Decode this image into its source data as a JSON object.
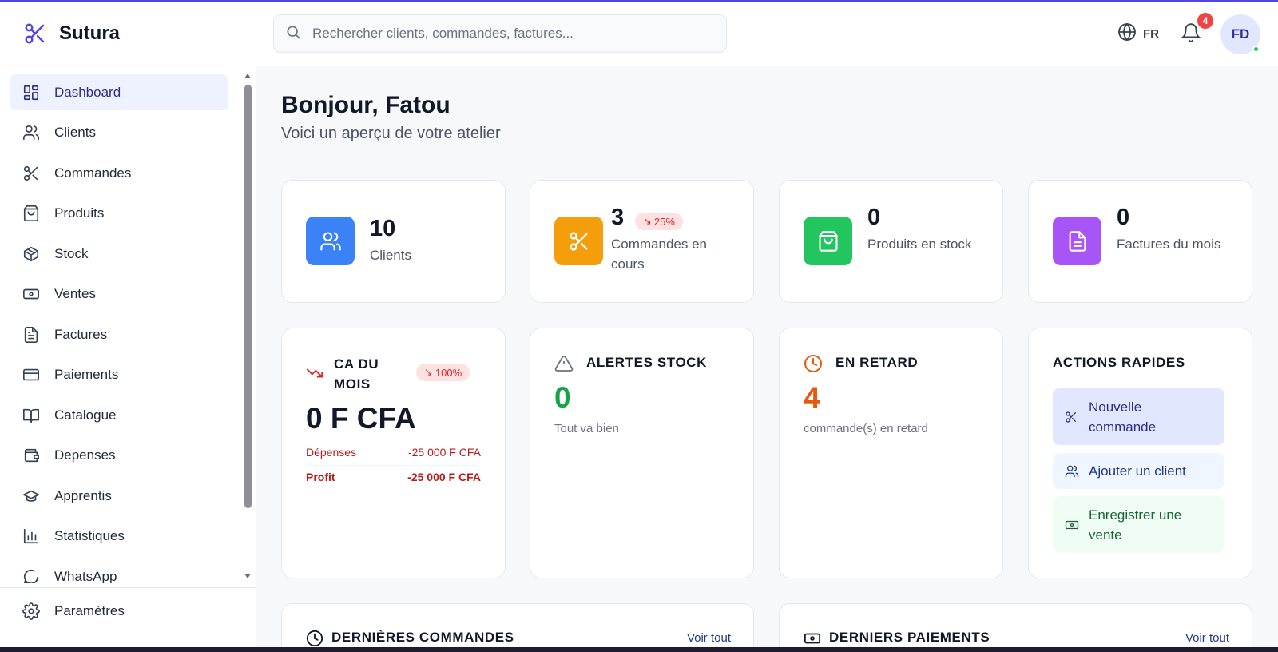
{
  "brand": {
    "name": "Sutura"
  },
  "sidebar": {
    "items": [
      {
        "label": "Dashboard",
        "icon": "dashboard-icon",
        "active": true
      },
      {
        "label": "Clients",
        "icon": "users-icon"
      },
      {
        "label": "Commandes",
        "icon": "scissors-icon"
      },
      {
        "label": "Produits",
        "icon": "shopping-bag-icon"
      },
      {
        "label": "Stock",
        "icon": "box-icon"
      },
      {
        "label": "Ventes",
        "icon": "banknote-icon"
      },
      {
        "label": "Factures",
        "icon": "file-text-icon"
      },
      {
        "label": "Paiements",
        "icon": "credit-card-icon"
      },
      {
        "label": "Catalogue",
        "icon": "book-open-icon"
      },
      {
        "label": "Depenses",
        "icon": "wallet-icon"
      },
      {
        "label": "Apprentis",
        "icon": "graduation-cap-icon"
      },
      {
        "label": "Statistiques",
        "icon": "bar-chart-icon"
      },
      {
        "label": "WhatsApp",
        "icon": "message-circle-icon"
      }
    ],
    "footer": {
      "label": "Paramètres",
      "icon": "settings-icon"
    }
  },
  "header": {
    "search_placeholder": "Rechercher clients, commandes, factures...",
    "lang": "FR",
    "notification_count": "4",
    "avatar_initials": "FD"
  },
  "main": {
    "greeting": "Bonjour, Fatou",
    "subtitle": "Voici un aperçu de votre atelier",
    "stats": [
      {
        "value": "10",
        "label": "Clients",
        "color": "#3b82f6"
      },
      {
        "value": "3",
        "label": "Commandes en cours",
        "trend": "25%",
        "color": "#f59e0b"
      },
      {
        "value": "0",
        "label": "Produits en stock",
        "color": "#22c55e"
      },
      {
        "value": "0",
        "label": "Factures du mois",
        "color": "#a855f7"
      }
    ],
    "revenue": {
      "title": "CA DU MOIS",
      "trend": "100%",
      "value": "0 F CFA",
      "expenses_label": "Dépenses",
      "expenses_value": "-25 000 F CFA",
      "profit_label": "Profit",
      "profit_value": "-25 000 F CFA"
    },
    "stock_alerts": {
      "title": "ALERTES STOCK",
      "value": "0",
      "note": "Tout va bien"
    },
    "late": {
      "title": "EN RETARD",
      "value": "4",
      "note": "commande(s) en retard"
    },
    "quick_actions": {
      "title": "ACTIONS RAPIDES",
      "buttons": [
        {
          "label": "Nouvelle commande"
        },
        {
          "label": "Ajouter un client"
        },
        {
          "label": "Enregistrer une vente"
        }
      ]
    },
    "recent_orders": {
      "title": "DERNIÈRES COMMANDES",
      "link": "Voir tout"
    },
    "recent_payments": {
      "title": "DERNIERS PAIEMENTS",
      "link": "Voir tout"
    }
  },
  "colors": {
    "accent": "#4f46e5",
    "success": "#16a34a",
    "danger": "#dc2626",
    "warning": "#ea580c"
  }
}
